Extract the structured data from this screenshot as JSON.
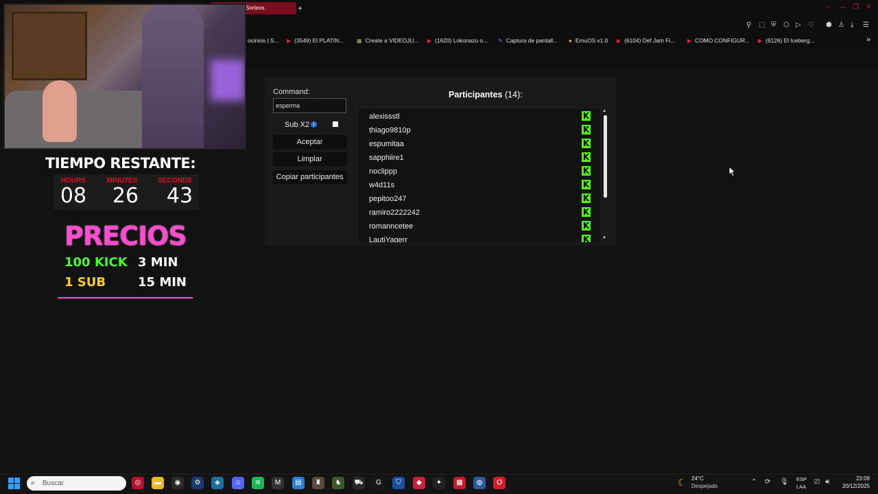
{
  "browser": {
    "active_tab": "Sorteos",
    "new_tab": "+",
    "bookmarks": [
      "ocinios | S...",
      "(3549) El PLATIN...",
      "Create a VIDEOJU...",
      "(1620) Lokonazo o...",
      "Captura de pantall...",
      "EmuOS v1.0",
      "(6104) Def Jam Fi...",
      "COMO CONFIGUR...",
      "(6126) El Iceberg..."
    ],
    "bookmarks_overflow": "»"
  },
  "overlay": {
    "timer_title": "TIEMPO RESTANTE:",
    "labels": [
      "HOURS",
      "MINUTES",
      "SECONDS"
    ],
    "hours": "08",
    "minutes": "26",
    "seconds": "43",
    "precios_title": "PRECIOS",
    "price1_item": "100 KICK",
    "price1_time": "3 MIN",
    "price2_item": "1 SUB",
    "price2_time": "15 MIN"
  },
  "app": {
    "command_label": "Command:",
    "command_value": "esperma",
    "sub_label": "Sub X2",
    "sub_checked": false,
    "btn_accept": "Aceptar",
    "btn_clear": "Limpiar",
    "btn_copy": "Copiar participantes",
    "participants_title": "Participantes",
    "participants_count": "(14):",
    "participants": [
      "alexissstl",
      "thiago9810p",
      "espumitaa",
      "sapphiire1",
      "noclippp",
      "w4d11s",
      "pepitoo247",
      "ramiro2222242",
      "romanncetee",
      "LautiYagerr"
    ],
    "kick_badge": "K",
    "kick_color": "#53fc18"
  },
  "taskbar": {
    "search_placeholder": "Buscar",
    "weather_temp": "24°C",
    "weather_desc": "Despejado",
    "lang1": "ESP",
    "lang2": "LAA",
    "time": "23:09",
    "date": "20/12/2025"
  }
}
